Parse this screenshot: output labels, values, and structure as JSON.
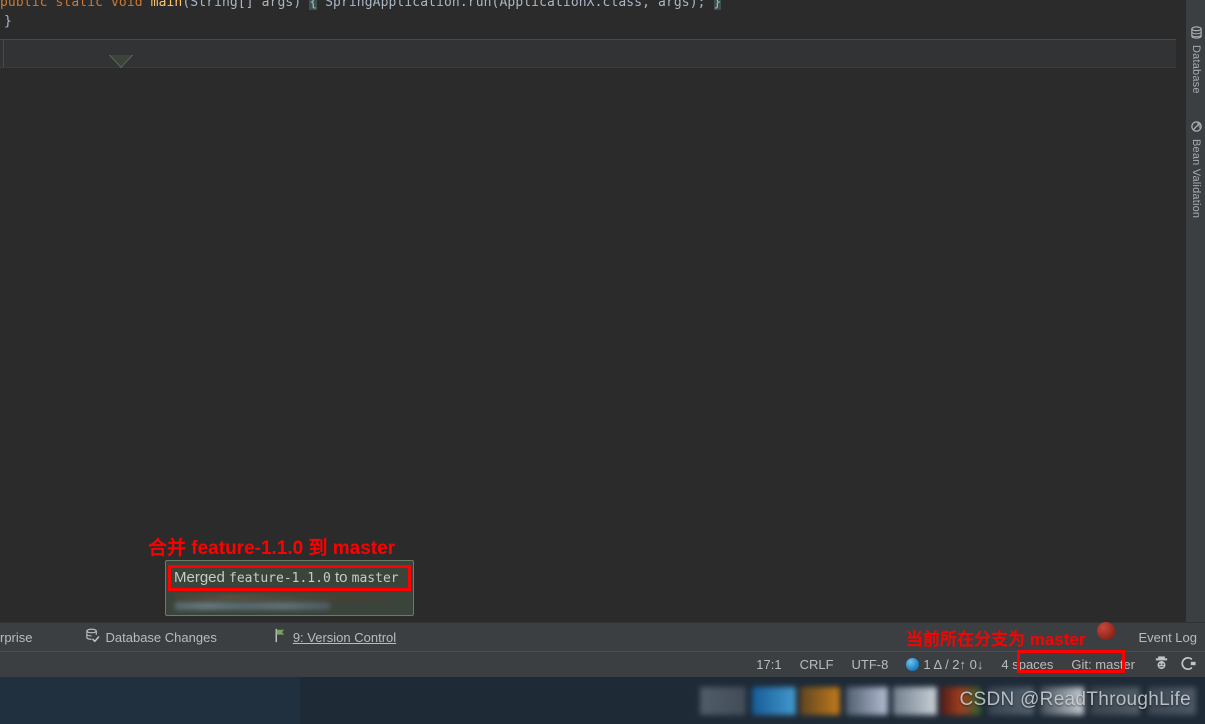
{
  "editor": {
    "code_line_1_parts": {
      "kw_public": "public",
      "kw_static": "static",
      "kw_void": "void",
      "method": "main",
      "params": "(String[] args)",
      "brace_open": "{",
      "body": "SpringApplication.run(ApplicationX.class, args);",
      "brace_close": "}"
    },
    "code_line_2": "}"
  },
  "right_strip": {
    "tabs": [
      {
        "label": "Database",
        "icon": "database-icon"
      },
      {
        "label": "Bean Validation",
        "icon": "bean-validation-icon"
      }
    ]
  },
  "toolwindow_bar": {
    "items": [
      {
        "label": "rprise",
        "icon": "enterprise-icon",
        "underline": ""
      },
      {
        "label": "Database Changes",
        "icon": "database-changes-icon",
        "underline": ""
      },
      {
        "label": "9: Version Control",
        "icon": "version-control-icon",
        "underline": "9"
      }
    ],
    "right_item": {
      "label": "Event Log",
      "icon": "event-log-icon"
    }
  },
  "status_bar": {
    "caret_position": "17:1",
    "line_separator": "CRLF",
    "encoding": "UTF-8",
    "inspection_icon": "inspection-circle-icon",
    "inspection_counts": "1 Δ / 2↑ 0↓",
    "indent": "4 spaces",
    "git_branch": "Git: master",
    "icons": [
      {
        "name": "hector-inspector-icon"
      },
      {
        "name": "power-save-icon"
      }
    ]
  },
  "popup": {
    "title_prefix": "Merged",
    "title_branch": "feature-1.1.0",
    "title_to": "to",
    "title_target": "master"
  },
  "annotations": {
    "merge_note": "合并 feature-1.1.0 到 master",
    "branch_note": "当前所在分支为 master",
    "accent_color": "#ff0000"
  },
  "taskbar": {
    "watermark": "CSDN @ReadThroughLife"
  }
}
